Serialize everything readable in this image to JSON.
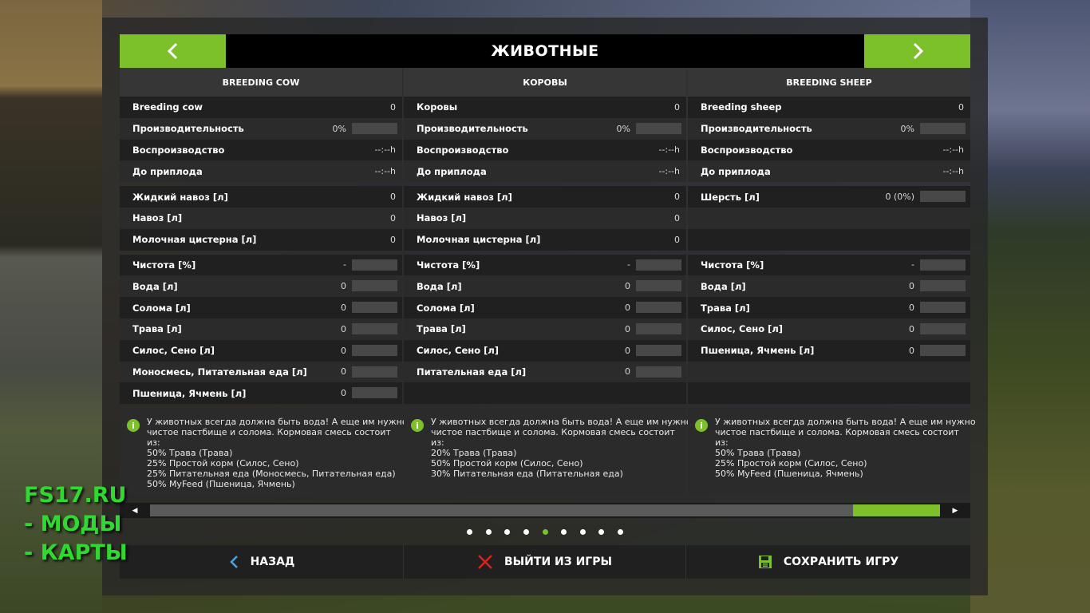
{
  "page": {
    "title": "ЖИВОТНЫЕ"
  },
  "columns": [
    {
      "header": "BREEDING COW",
      "groups": [
        [
          {
            "label": "Breeding cow",
            "value": "0",
            "bar": false
          },
          {
            "label": "Производительность",
            "value": "0%",
            "bar": true
          },
          {
            "label": "Воспроизводство",
            "value": "--:--h",
            "bar": false
          },
          {
            "label": "До приплода",
            "value": "--:--h",
            "bar": false
          }
        ],
        [
          {
            "label": "Жидкий навоз [л]",
            "value": "0",
            "bar": false
          },
          {
            "label": "Навоз [л]",
            "value": "0",
            "bar": false
          },
          {
            "label": "Молочная цистерна [л]",
            "value": "0",
            "bar": false
          }
        ],
        [
          {
            "label": "Чистота [%]",
            "value": "-",
            "bar": true
          },
          {
            "label": "Вода [л]",
            "value": "0",
            "bar": true
          },
          {
            "label": "Солома [л]",
            "value": "0",
            "bar": true
          },
          {
            "label": "Трава [л]",
            "value": "0",
            "bar": true
          },
          {
            "label": "Силос, Сено [л]",
            "value": "0",
            "bar": true
          },
          {
            "label": "Моносмесь, Питательная еда [л]",
            "value": "0",
            "bar": true
          },
          {
            "label": "Пшеница, Ячмень [л]",
            "value": "0",
            "bar": true
          }
        ]
      ],
      "info": [
        "У животных всегда должна быть вода! А еще им нужно",
        "чистое пастбище и солома. Кормовая смесь состоит",
        "из:",
        "50% Трава (Трава)",
        "25% Простой корм (Силос, Сено)",
        "25% Питательная еда (Моносмесь, Питательная еда)",
        "50% MyFeed (Пшеница, Ячмень)"
      ]
    },
    {
      "header": "КОРОВЫ",
      "groups": [
        [
          {
            "label": "Коровы",
            "value": "0",
            "bar": false
          },
          {
            "label": "Производительность",
            "value": "0%",
            "bar": true
          },
          {
            "label": "Воспроизводство",
            "value": "--:--h",
            "bar": false
          },
          {
            "label": "До приплода",
            "value": "--:--h",
            "bar": false
          }
        ],
        [
          {
            "label": "Жидкий навоз [л]",
            "value": "0",
            "bar": false
          },
          {
            "label": "Навоз [л]",
            "value": "0",
            "bar": false
          },
          {
            "label": "Молочная цистерна [л]",
            "value": "0",
            "bar": false
          }
        ],
        [
          {
            "label": "Чистота [%]",
            "value": "-",
            "bar": true
          },
          {
            "label": "Вода [л]",
            "value": "0",
            "bar": true
          },
          {
            "label": "Солома [л]",
            "value": "0",
            "bar": true
          },
          {
            "label": "Трава [л]",
            "value": "0",
            "bar": true
          },
          {
            "label": "Силос, Сено [л]",
            "value": "0",
            "bar": true
          },
          {
            "label": "Питательная еда [л]",
            "value": "0",
            "bar": true
          },
          {
            "label": "",
            "value": "",
            "bar": false
          }
        ]
      ],
      "info": [
        "У животных всегда должна быть вода! А еще им нужно",
        "чистое пастбище и солома. Кормовая смесь состоит",
        "из:",
        "20% Трава (Трава)",
        "50% Простой корм (Силос, Сено)",
        "30% Питательная еда (Питательная еда)"
      ]
    },
    {
      "header": "BREEDING SHEEP",
      "groups": [
        [
          {
            "label": "Breeding sheep",
            "value": "0",
            "bar": false
          },
          {
            "label": "Производительность",
            "value": "0%",
            "bar": true
          },
          {
            "label": "Воспроизводство",
            "value": "--:--h",
            "bar": false
          },
          {
            "label": "До приплода",
            "value": "--:--h",
            "bar": false
          }
        ],
        [
          {
            "label": "Шерсть [л]",
            "value": "0 (0%)",
            "bar": true
          },
          {
            "label": "",
            "value": "",
            "bar": false
          },
          {
            "label": "",
            "value": "",
            "bar": false
          }
        ],
        [
          {
            "label": "Чистота [%]",
            "value": "-",
            "bar": true
          },
          {
            "label": "Вода [л]",
            "value": "0",
            "bar": true
          },
          {
            "label": "Трава [л]",
            "value": "0",
            "bar": true
          },
          {
            "label": "Силос, Сено [л]",
            "value": "0",
            "bar": true
          },
          {
            "label": "Пшеница, Ячмень [л]",
            "value": "0",
            "bar": true
          },
          {
            "label": "",
            "value": "",
            "bar": false
          },
          {
            "label": "",
            "value": "",
            "bar": false
          }
        ]
      ],
      "info": [
        "У животных всегда должна быть вода! А еще им нужно",
        "чистое пастбище и солома. Кормовая смесь состоит",
        "из:",
        "50% Трава (Трава)",
        "25% Простой корм (Силос, Сено)",
        "50% MyFeed (Пшеница, Ячмень)"
      ]
    }
  ],
  "scrollbar": {
    "position_fraction": 1.0,
    "visible_fraction": 0.11
  },
  "pagination": {
    "count": 9,
    "active_index": 4
  },
  "bottom_bar": {
    "back_label": "НАЗАД",
    "quit_label": "ВЫЙТИ ИЗ ИГРЫ",
    "save_label": "СОХРАНИТЬ ИГРУ"
  },
  "watermark": {
    "lines": [
      "FS17.RU",
      " - МОДЫ",
      " - КАРТЫ"
    ]
  },
  "colors": {
    "accent": "#7dc12a",
    "quit_icon": "#e0201f",
    "back_icon": "#4aa3df",
    "watermark": "#2fd92f"
  },
  "icons": {
    "nav_prev": "chevron-left-icon",
    "nav_next": "chevron-right-icon",
    "info": "info-icon",
    "back": "chevron-left-icon",
    "quit": "close-icon",
    "save": "floppy-disk-icon"
  }
}
